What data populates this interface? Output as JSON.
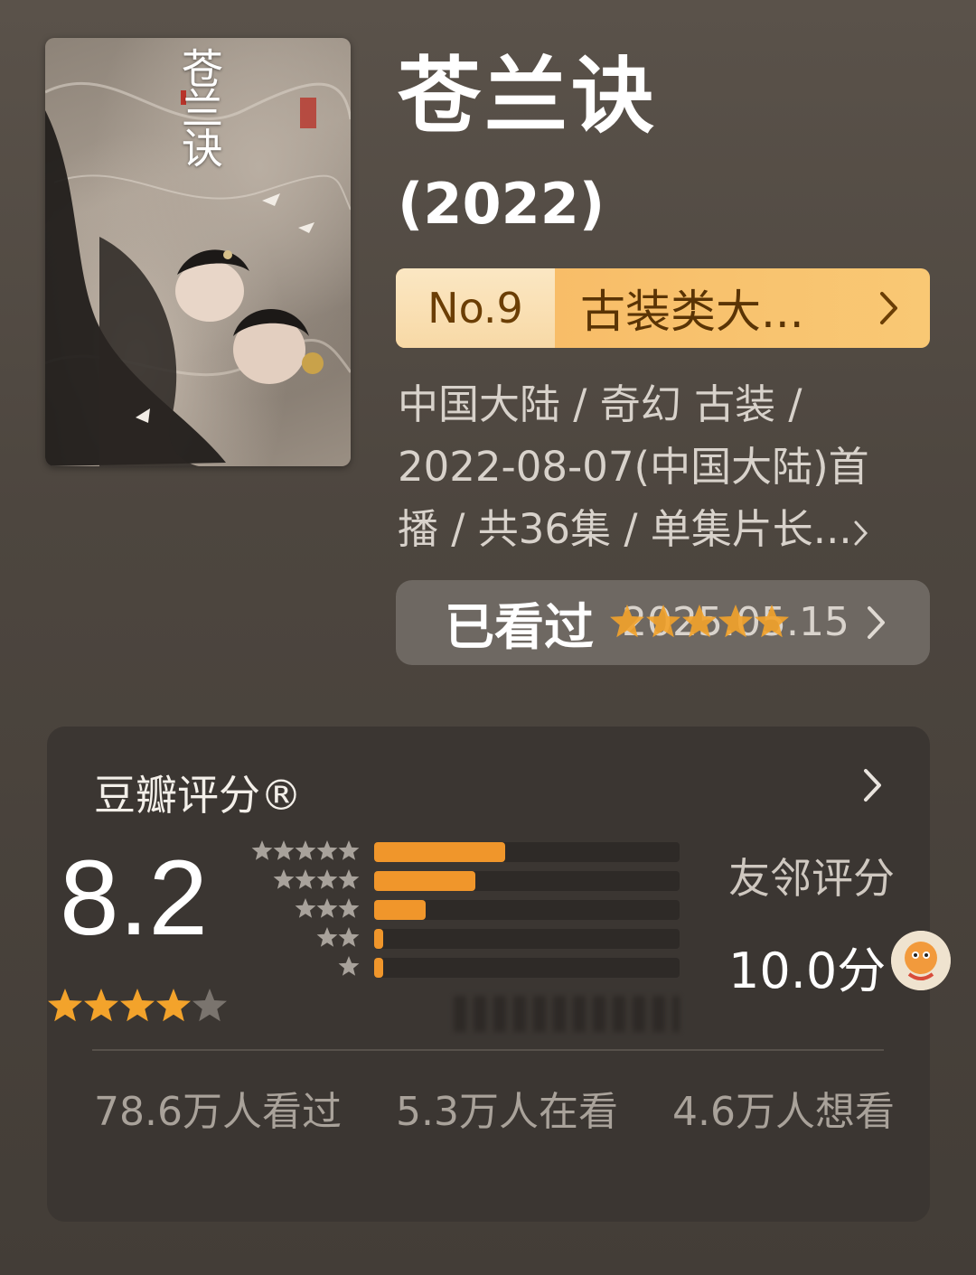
{
  "movie": {
    "title": "苍兰诀",
    "year": "(2022)",
    "poster_title": "苍兰诀",
    "rank_no": "No.9",
    "rank_label": "古装类大...",
    "meta_line1": "中国大陆 / 奇幻 古装 /",
    "meta_line2": "2022-08-07(中国大陆)首",
    "meta_line3": "播 / 共36集 / 单集片长..."
  },
  "watched": {
    "label": "已看过",
    "date": "2025.05.15",
    "user_stars": 5
  },
  "rating": {
    "section_title": "豆瓣评分®",
    "score": "8.2",
    "stars": 4,
    "distribution_fraction": [
      0.43,
      0.33,
      0.17,
      0.03,
      0.03
    ],
    "friends_label": "友邻评分",
    "friends_score": "10.0分",
    "watched_count": "78.6万人看过",
    "watching_count": "5.3万人在看",
    "want_count": "4.6万人想看"
  },
  "colors": {
    "accent_orange": "#f0962b",
    "star": "#f3a32b",
    "rank_banner": "#f8c26e"
  },
  "icons": [
    "chevron-right-icon",
    "star-icon",
    "friend-avatar-icon"
  ]
}
